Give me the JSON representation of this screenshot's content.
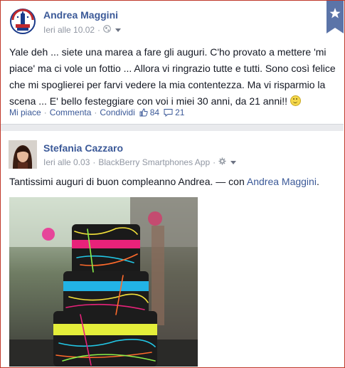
{
  "post1": {
    "author": "Andrea Maggini",
    "timestamp": "Ieri alle 10.02",
    "text": "Yale deh ... siete una marea a fare gli auguri. C'ho provato a mettere 'mi piace' ma ci vole un fottio ... Allora vi ringrazio tutte e tutti. Sono così felice che mi spoglierei per farvi vedere la mia contentezza. Ma vi risparmio la scena ... E' bello festeggiare con voi i miei 30 anni, da 21 anni!!",
    "actions": {
      "like": "Mi piace",
      "comment": "Commenta",
      "share": "Condividi",
      "likes_count": "84",
      "comments_count": "21"
    }
  },
  "post2": {
    "author": "Stefania Cazzaro",
    "timestamp": "Ieri alle 0.03",
    "via": "BlackBerry Smartphones App",
    "text_prefix": "Tantissimi auguri di buon compleanno Andrea. — con ",
    "tagged": "Andrea Maggini",
    "text_suffix": "."
  },
  "icons": [
    "globe-icon",
    "star-icon",
    "like-icon",
    "comment-icon",
    "gear-icon",
    "chevron-down-icon",
    "smiley-icon"
  ],
  "colors": {
    "link": "#3b5998",
    "meta": "#9197a3",
    "divider": "#e9eaed",
    "star_tab": "#5b74a8"
  }
}
